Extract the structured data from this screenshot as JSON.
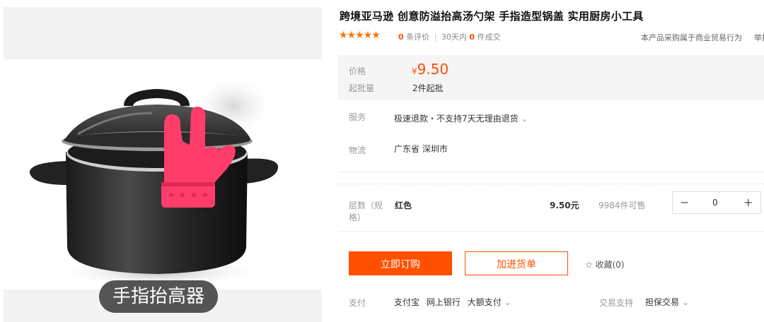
{
  "product": {
    "title": "跨境亚马逊 创意防溢抬高汤勺架 手指造型锅盖 实用厨房小工具",
    "image_caption": "手指抬高器"
  },
  "rating": {
    "stars": "★★★★★",
    "review_count": "0",
    "review_label": "条评价",
    "sep": "|",
    "period_label": "30天内",
    "sold_count": "0",
    "sold_label": "件成交",
    "notice": "本产品采购属于商业贸易行为",
    "report": "举报"
  },
  "price": {
    "label": "价格",
    "currency": "¥",
    "value": "9.50",
    "moq_label": "起批量",
    "moq_value": "2件起批"
  },
  "service": {
    "label": "服务",
    "value": "极速退款・不支持7天无理由退货",
    "chevron": "⌄"
  },
  "logistics": {
    "label": "物流",
    "value": "广东省 深圳市"
  },
  "sku": {
    "label": "层数（规格）",
    "color": "红色",
    "price": "9.50元",
    "stock": "9984件可售",
    "minus": "−",
    "quantity": "0",
    "plus": "+"
  },
  "actions": {
    "order": "立即订购",
    "cart": "加进货单",
    "favorite_icon": "☆",
    "favorite": "收藏(0)"
  },
  "payment": {
    "label": "支付",
    "methods": [
      "支付宝",
      "网上银行",
      "大额支付"
    ],
    "chevron": "⌄",
    "trade_label": "交易支持",
    "trade_value": "担保交易"
  },
  "colors": {
    "accent": "#ff5000",
    "star": "#ff7300"
  }
}
